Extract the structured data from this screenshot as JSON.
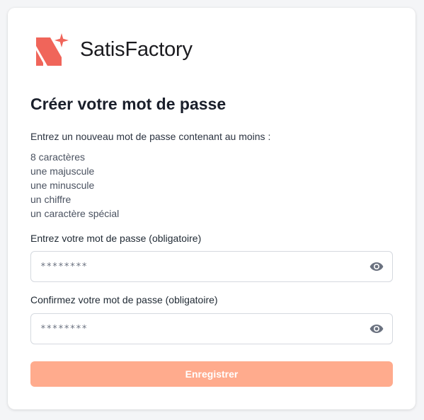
{
  "brand": {
    "name": "SatisFactory",
    "mark_color": "#f0655a",
    "logo_icon": "satisfactory-s-sparkle-logo"
  },
  "page": {
    "title": "Créer votre mot de passe",
    "intro": "Entrez un nouveau mot de passe contenant au moins :",
    "requirements": [
      "8 caractères",
      "une majuscule",
      "une minuscule",
      "un chiffre",
      "un caractère spécial"
    ]
  },
  "form": {
    "password": {
      "label": "Entrez votre mot de passe (obligatoire)",
      "placeholder": "********",
      "value": "",
      "icon": "eye-icon"
    },
    "confirm": {
      "label": "Confirmez votre mot de passe (obligatoire)",
      "placeholder": "********",
      "value": "",
      "icon": "eye-icon"
    },
    "submit_label": "Enregistrer",
    "submit_color": "#ffab8d",
    "submit_disabled": true
  }
}
